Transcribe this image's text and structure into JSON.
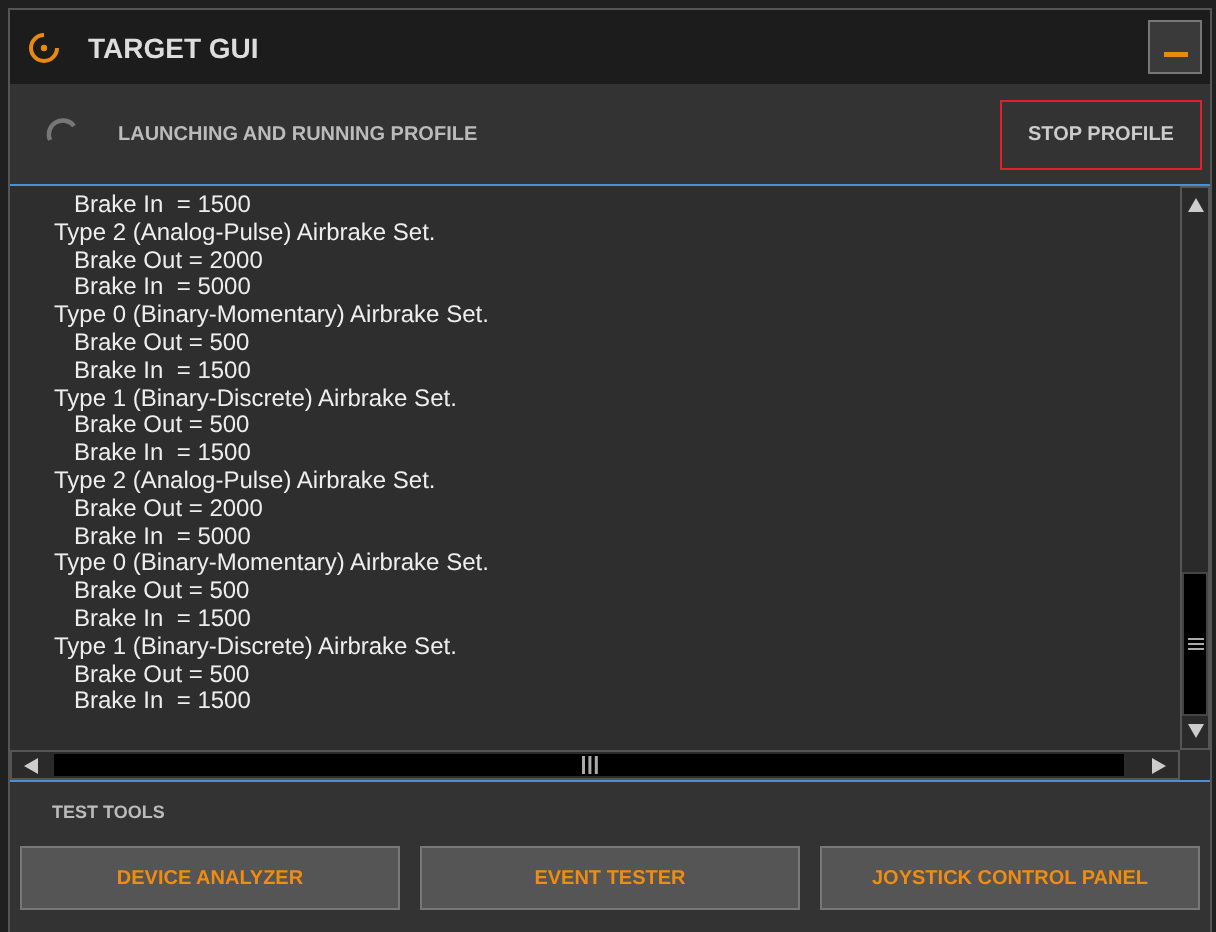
{
  "window": {
    "title": "TARGET GUI"
  },
  "status": {
    "message": "LAUNCHING AND RUNNING PROFILE",
    "button": "STOP PROFILE"
  },
  "log": [
    {
      "text": "Brake In  = 1500"
    },
    {
      "text": "Type 2 (Analog-Pulse) Airbrake Set.",
      "children": [
        {
          "text": "Brake Out = 2000"
        },
        {
          "text": "Brake In  = 5000"
        }
      ]
    },
    {
      "text": "Type 0 (Binary-Momentary) Airbrake Set.",
      "children": [
        {
          "text": "Brake Out = 500"
        },
        {
          "text": "Brake In  = 1500"
        }
      ]
    },
    {
      "text": "Type 1 (Binary-Discrete) Airbrake Set.",
      "children": [
        {
          "text": "Brake Out = 500"
        },
        {
          "text": "Brake In  = 1500"
        }
      ]
    },
    {
      "text": "Type 2 (Analog-Pulse) Airbrake Set.",
      "children": [
        {
          "text": "Brake Out = 2000"
        },
        {
          "text": "Brake In  = 5000"
        }
      ]
    },
    {
      "text": "Type 0 (Binary-Momentary) Airbrake Set.",
      "children": [
        {
          "text": "Brake Out = 500"
        },
        {
          "text": "Brake In  = 1500"
        }
      ]
    },
    {
      "text": "Type 1 (Binary-Discrete) Airbrake Set.",
      "children": [
        {
          "text": "Brake Out = 500"
        },
        {
          "text": "Brake In  = 1500"
        }
      ]
    }
  ],
  "test_tools": {
    "heading": "TEST TOOLS",
    "buttons": [
      "DEVICE ANALYZER",
      "EVENT TESTER",
      "JOYSTICK CONTROL PANEL"
    ]
  }
}
